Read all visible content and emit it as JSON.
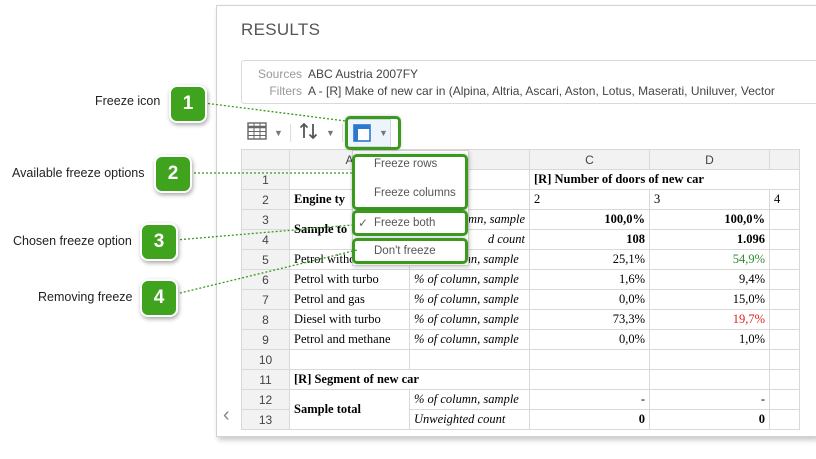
{
  "panel": {
    "title": "RESULTS",
    "sources_label": "Sources",
    "sources_value": "ABC Austria 2007FY",
    "filters_label": "Filters",
    "filters_value": "A - [R] Make of new car in (Alpina, Altria, Ascari, Aston, Lotus, Maserati, Uniluver, Vector"
  },
  "toolbar": {
    "items": [
      "table-view-icon",
      "sort-icon",
      "freeze-icon"
    ]
  },
  "freeze_menu": {
    "items": [
      "Freeze rows",
      "Freeze columns",
      "Freeze both",
      "Don't freeze"
    ],
    "selected": "Freeze both"
  },
  "grid": {
    "col_headers": [
      "A",
      "",
      "C",
      "D",
      ""
    ],
    "row_numbers": [
      "1",
      "2",
      "3",
      "4",
      "5",
      "6",
      "7",
      "8",
      "9",
      "10",
      "11",
      "12",
      "13"
    ],
    "r1_title": "[R] Number of doors of new car",
    "r2": {
      "a": "Engine ty",
      "c": "2",
      "d": "3",
      "e": "4"
    },
    "r3": {
      "a": "Sample to",
      "b": "column, sample",
      "c": "100,0%",
      "d": "100,0%"
    },
    "r4": {
      "b": "d count",
      "c": "108",
      "d": "1.096"
    },
    "rows": [
      {
        "a": "Petrol without turbo",
        "b": "% of column, sample",
        "c": "25,1%",
        "d": "54,9%"
      },
      {
        "a": "Petrol with turbo",
        "b": "% of column, sample",
        "c": "1,6%",
        "d": "9,4%"
      },
      {
        "a": "Petrol and gas",
        "b": "% of column, sample",
        "c": "0,0%",
        "d": "15,0%"
      },
      {
        "a": "Diesel with turbo",
        "b": "% of column, sample",
        "c": "73,3%",
        "d": "19,7%"
      },
      {
        "a": "Petrol and methane",
        "b": "% of column, sample",
        "c": "0,0%",
        "d": "1,0%"
      }
    ],
    "r11_title": "[R] Segment of new car",
    "r12": {
      "a": "Sample total",
      "b": "% of column, sample",
      "c": "-",
      "d": "-"
    },
    "r13": {
      "b": "Unweighted count",
      "c": "0",
      "d": "0"
    }
  },
  "callouts": [
    {
      "num": "1",
      "label": "Freeze icon"
    },
    {
      "num": "2",
      "label": "Available freeze options"
    },
    {
      "num": "3",
      "label": "Chosen freeze option"
    },
    {
      "num": "4",
      "label": "Removing freeze"
    }
  ],
  "colors": {
    "accent_green": "#3a9a1e",
    "positive": "#2e8b2e",
    "negative": "#e02020"
  }
}
